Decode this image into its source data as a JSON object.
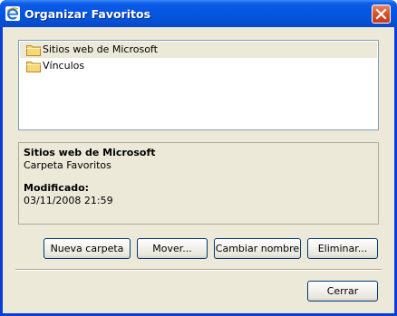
{
  "window": {
    "title": "Organizar Favoritos",
    "icon": "internet-explorer-icon"
  },
  "list": {
    "items": [
      {
        "label": "Sitios web de Microsoft",
        "icon": "folder-icon",
        "selected": true
      },
      {
        "label": "Vínculos",
        "icon": "folder-icon",
        "selected": false
      }
    ]
  },
  "details": {
    "name": "Sitios web de Microsoft",
    "type": "Carpeta Favoritos",
    "modified_label": "Modificado:",
    "modified_value": "03/11/2008 21:59"
  },
  "buttons": {
    "new_folder": "Nueva carpeta",
    "move": "Mover...",
    "rename": "Cambiar nombre",
    "delete": "Eliminar...",
    "close": "Cerrar"
  },
  "colors": {
    "titlebar": "#0556e3",
    "dialog_bg": "#ece9d8",
    "close_button": "#d9532a"
  }
}
